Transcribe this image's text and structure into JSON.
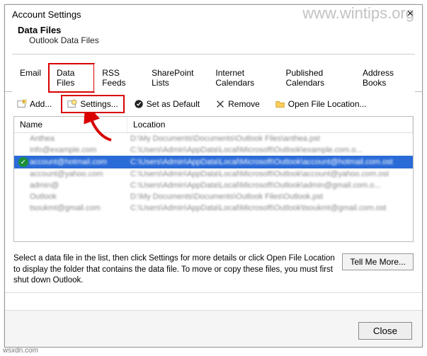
{
  "watermark": "www.wintips.org",
  "wsxdn": "wsxdn.com",
  "dialog": {
    "title": "Account Settings",
    "close_x": "×",
    "sub_title": "Data Files",
    "sub_desc": "Outlook Data Files"
  },
  "tabs": {
    "email": "Email",
    "datafiles": "Data Files",
    "rss": "RSS Feeds",
    "sharepoint": "SharePoint Lists",
    "internet": "Internet Calendars",
    "published": "Published Calendars",
    "address": "Address Books"
  },
  "toolbar": {
    "add": "Add...",
    "settings": "Settings...",
    "default": "Set as Default",
    "remove": "Remove",
    "openloc": "Open File Location..."
  },
  "list": {
    "head_name": "Name",
    "head_location": "Location",
    "rows": [
      {
        "default": false,
        "name": "Anthea",
        "location": "D:\\My Documents\\Documents\\Outlook Files\\anthea.pst"
      },
      {
        "default": false,
        "name": "info@example.com",
        "location": "C:\\Users\\Admin\\AppData\\Local\\Microsoft\\Outlook\\example.com.o..."
      },
      {
        "default": true,
        "name": "account@hotmail.com",
        "location": "C:\\Users\\Admin\\AppData\\Local\\Microsoft\\Outlook\\account@hotmail.com.ost"
      },
      {
        "default": false,
        "name": "account@yahoo.com",
        "location": "C:\\Users\\Admin\\AppData\\Local\\Microsoft\\Outlook\\account@yahoo.com.ost"
      },
      {
        "default": false,
        "name": "admin@",
        "location": "C:\\Users\\Admin\\AppData\\Local\\Microsoft\\Outlook\\admin@gmail.com.o..."
      },
      {
        "default": false,
        "name": "Outlook",
        "location": "D:\\My Documents\\Documents\\Outlook Files\\Outlook.pst"
      },
      {
        "default": false,
        "name": "tsoukmt@gmail.com",
        "location": "C:\\Users\\Admin\\AppData\\Local\\Microsoft\\Outlook\\tsoukmt@gmail.com.ost"
      }
    ]
  },
  "footer": {
    "text": "Select a data file in the list, then click Settings for more details or click Open File Location to display the folder that contains the data file. To move or copy these files, you must first shut down Outlook.",
    "tellmore": "Tell Me More..."
  },
  "close_btn": "Close"
}
